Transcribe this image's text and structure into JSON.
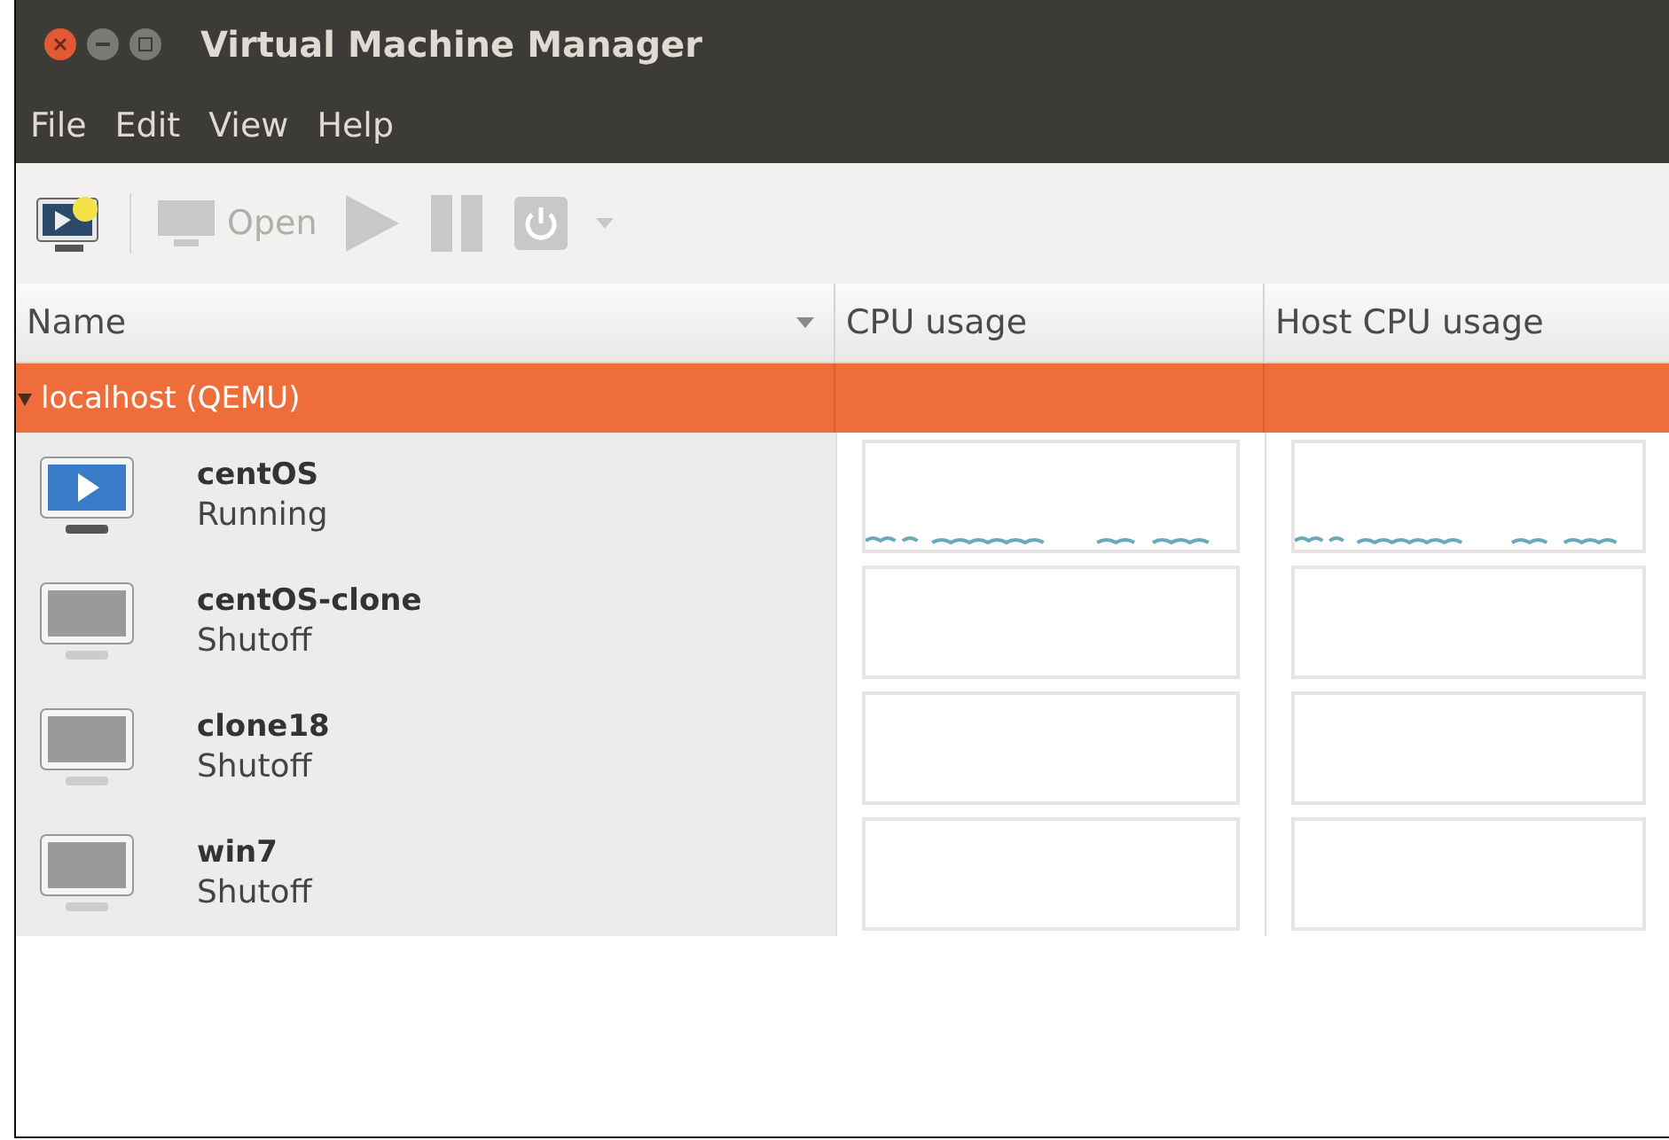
{
  "window": {
    "title": "Virtual Machine Manager"
  },
  "menu": [
    "File",
    "Edit",
    "View",
    "Help"
  ],
  "toolbar": [
    {
      "kind": "new",
      "disabled": false
    },
    {
      "kind": "open",
      "label": "Open",
      "disabled": true
    },
    {
      "kind": "run",
      "disabled": true
    },
    {
      "kind": "pause",
      "disabled": true
    },
    {
      "kind": "shutdown",
      "disabled": true
    },
    {
      "kind": "menu",
      "disabled": true
    }
  ],
  "table": {
    "columns": [
      "Name",
      "CPU usage",
      "Host CPU usage"
    ],
    "groups": [
      {
        "label": "localhost (QEMU)",
        "expanded": true,
        "selected": true,
        "rows": [
          {
            "name": "centOS",
            "status": "Running",
            "running": true
          },
          {
            "name": "centOS-clone",
            "status": "Shutoff",
            "running": false
          },
          {
            "name": "clone18",
            "status": "Shutoff",
            "running": false
          },
          {
            "name": "win7",
            "status": "Shutoff",
            "running": false
          }
        ]
      }
    ]
  }
}
